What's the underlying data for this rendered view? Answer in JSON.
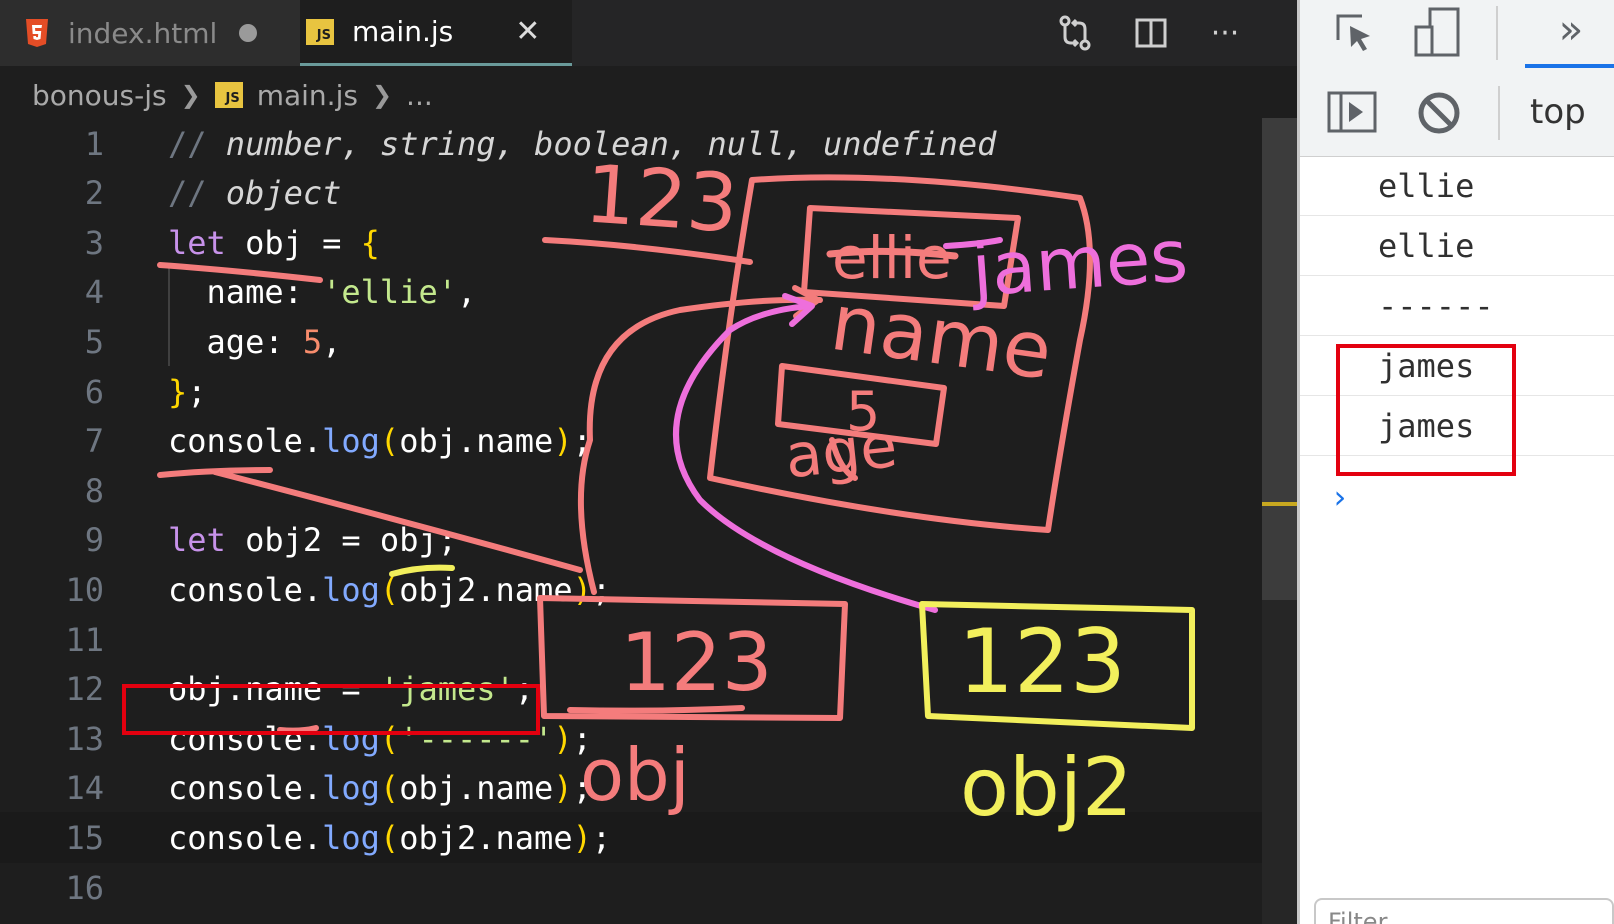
{
  "tabs": [
    {
      "label": "index.html",
      "icon": "html5-icon",
      "dirty": true
    },
    {
      "label": "main.js",
      "icon": "js-file-icon",
      "active": true
    }
  ],
  "toolbar": {
    "more_label": "···"
  },
  "js_badge": "JS",
  "breadcrumb": {
    "folder": "bonous-js",
    "file": "main.js",
    "more": "..."
  },
  "code_lines": [
    {
      "n": "1",
      "text": "// number, string, boolean, null, undefined"
    },
    {
      "n": "2",
      "text": "// object"
    },
    {
      "n": "3",
      "text": "let obj = {"
    },
    {
      "n": "4",
      "text": "  name: 'ellie',"
    },
    {
      "n": "5",
      "text": "  age: 5,"
    },
    {
      "n": "6",
      "text": "};"
    },
    {
      "n": "7",
      "text": "console.log(obj.name);"
    },
    {
      "n": "8",
      "text": ""
    },
    {
      "n": "9",
      "text": "let obj2 = obj;"
    },
    {
      "n": "10",
      "text": "console.log(obj2.name);"
    },
    {
      "n": "11",
      "text": ""
    },
    {
      "n": "12",
      "text": "obj.name = 'james';"
    },
    {
      "n": "13",
      "text": "console.log('------');"
    },
    {
      "n": "14",
      "text": "console.log(obj.name);"
    },
    {
      "n": "15",
      "text": "console.log(obj2.name);"
    },
    {
      "n": "16",
      "text": ""
    }
  ],
  "devtools": {
    "context": "top",
    "console_output": [
      "ellie",
      "ellie",
      "------",
      "james",
      "james"
    ],
    "prompt": "›",
    "filter_placeholder": "Filter"
  },
  "annotations": {
    "address_1": "123",
    "address_2": "123",
    "address_3": "123",
    "label_obj": "obj",
    "label_obj2": "obj2",
    "field_name": "name",
    "field_age": "age",
    "value_age": "5",
    "new_value": "james",
    "old_value": "ellie"
  },
  "colors": {
    "pen_salmon": "#f47c7c",
    "pen_pink": "#ee6fdc",
    "pen_yellow": "#f2ef5c",
    "highlight_red": "#e3000f",
    "accent_blue": "#1a73e8"
  }
}
